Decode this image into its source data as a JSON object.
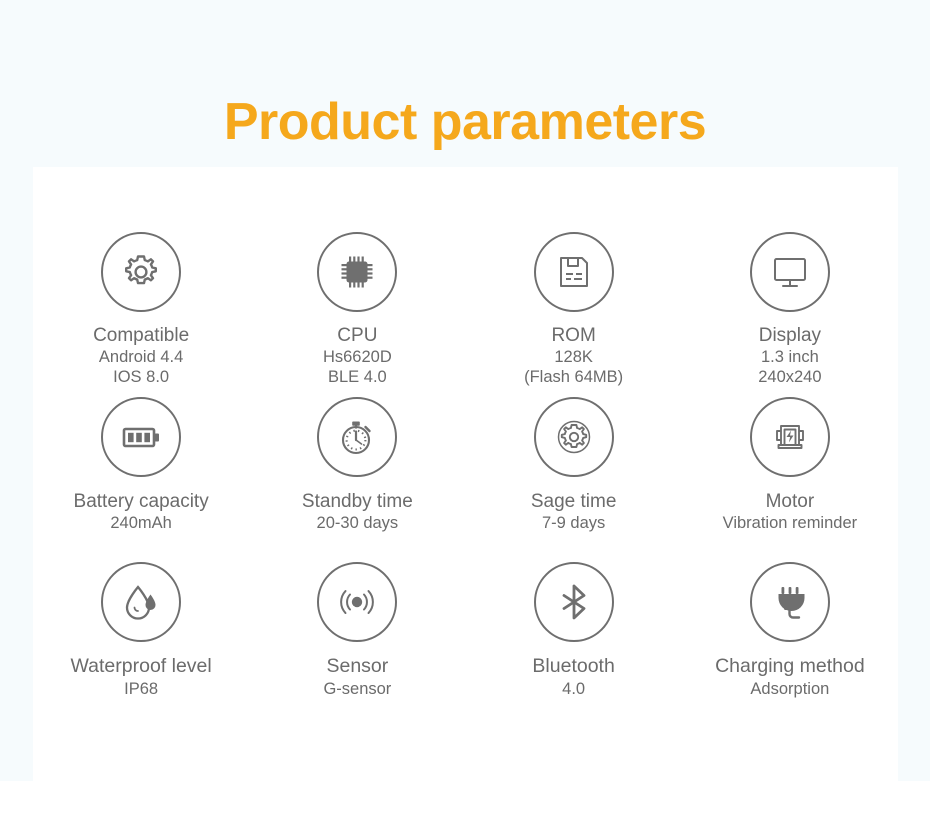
{
  "page": {
    "title": "Product parameters",
    "title_color": "#f5a81c",
    "background_color": "#f6fbfd",
    "panel_color": "#ffffff",
    "icon_color": "#6f6f6f",
    "text_color": "#6b6b6b"
  },
  "specs": [
    {
      "icon": "gear-icon",
      "title": "Compatible",
      "sub1": "Android 4.4",
      "sub2": "IOS 8.0"
    },
    {
      "icon": "cpu-chip-icon",
      "title": "CPU",
      "sub1": "Hs6620D",
      "sub2": "BLE 4.0"
    },
    {
      "icon": "floppy-disk-icon",
      "title": "ROM",
      "sub1": "128K",
      "sub2": "(Flash 64MB)"
    },
    {
      "icon": "monitor-icon",
      "title": "Display",
      "sub1": "1.3 inch",
      "sub2": "240x240"
    },
    {
      "icon": "battery-icon",
      "title": "Battery capacity",
      "sub1": "240mAh",
      "sub2": ""
    },
    {
      "icon": "stopwatch-icon",
      "title": "Standby time",
      "sub1": "20-30 days",
      "sub2": ""
    },
    {
      "icon": "gear-outline-icon",
      "title": "Sage time",
      "sub1": "7-9 days",
      "sub2": ""
    },
    {
      "icon": "motor-icon",
      "title": "Motor",
      "sub1": "Vibration reminder",
      "sub2": ""
    },
    {
      "icon": "water-drop-icon",
      "title": "Waterproof level",
      "sub1": "IP68",
      "sub2": ""
    },
    {
      "icon": "signal-sensor-icon",
      "title": "Sensor",
      "sub1": "G-sensor",
      "sub2": ""
    },
    {
      "icon": "bluetooth-icon",
      "title": "Bluetooth",
      "sub1": "4.0",
      "sub2": ""
    },
    {
      "icon": "power-plug-icon",
      "title": "Charging method",
      "sub1": "Adsorption",
      "sub2": ""
    }
  ]
}
